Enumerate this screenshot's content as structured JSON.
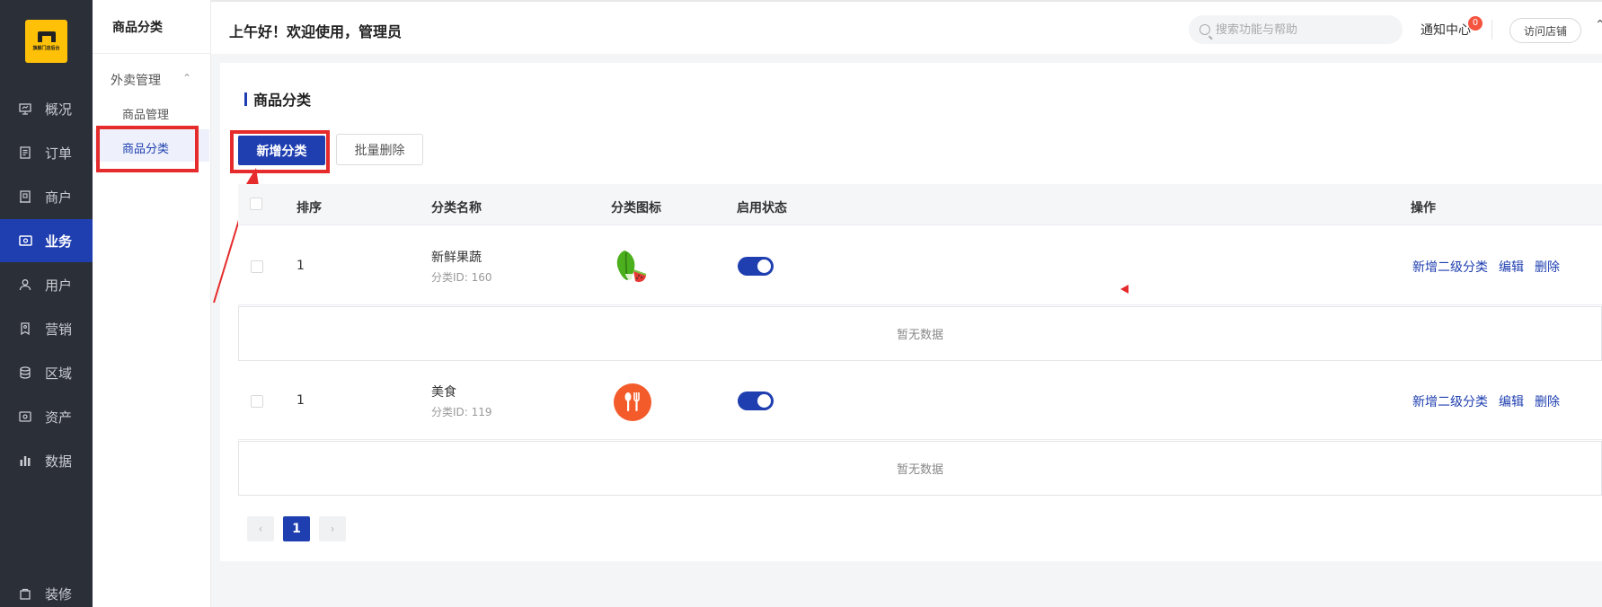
{
  "nav": {
    "logo_text": "旗舰门店后台",
    "items": [
      {
        "label": "概况",
        "icon": "presentation-icon"
      },
      {
        "label": "订单",
        "icon": "document-icon"
      },
      {
        "label": "商户",
        "icon": "building-icon"
      },
      {
        "label": "业务",
        "icon": "wallet-icon"
      },
      {
        "label": "用户",
        "icon": "user-icon"
      },
      {
        "label": "营销",
        "icon": "tag-icon"
      },
      {
        "label": "区域",
        "icon": "database-icon"
      },
      {
        "label": "资产",
        "icon": "asset-icon"
      },
      {
        "label": "数据",
        "icon": "bar-chart-icon"
      },
      {
        "label": "装修",
        "icon": "bag-icon"
      }
    ],
    "active": "业务"
  },
  "subnav": {
    "title": "商品分类",
    "group": "外卖管理",
    "items": [
      "商品管理",
      "商品分类"
    ],
    "active": "商品分类"
  },
  "header": {
    "greeting": "上午好！欢迎使用，管理员",
    "search_placeholder": "搜索功能与帮助",
    "notice_label": "通知中心",
    "notice_count": "0",
    "visit_label": "访问店铺",
    "more": "⌃"
  },
  "page": {
    "title": "商品分类",
    "add_button": "新增分类",
    "batch_delete_button": "批量删除",
    "columns": [
      "排序",
      "分类名称",
      "分类图标",
      "启用状态",
      "操作"
    ],
    "rows": [
      {
        "sort": "1",
        "name": "新鲜果蔬",
        "id_text": "分类ID: 160",
        "icon": "vegetable-icon",
        "enabled": true
      },
      {
        "sort": "1",
        "name": "美食",
        "id_text": "分类ID: 119",
        "icon": "utensils-icon",
        "enabled": true
      }
    ],
    "row_actions": [
      "新增二级分类",
      "编辑",
      "删除"
    ],
    "empty_text": "暂无数据",
    "pagination": {
      "current": "1",
      "prev": "‹",
      "next": "›"
    }
  },
  "colors": {
    "accent": "#1f3fb0",
    "nav_bg": "#2b2f38",
    "highlight_red": "#e52b2b",
    "logo_yellow": "#ffc107"
  }
}
